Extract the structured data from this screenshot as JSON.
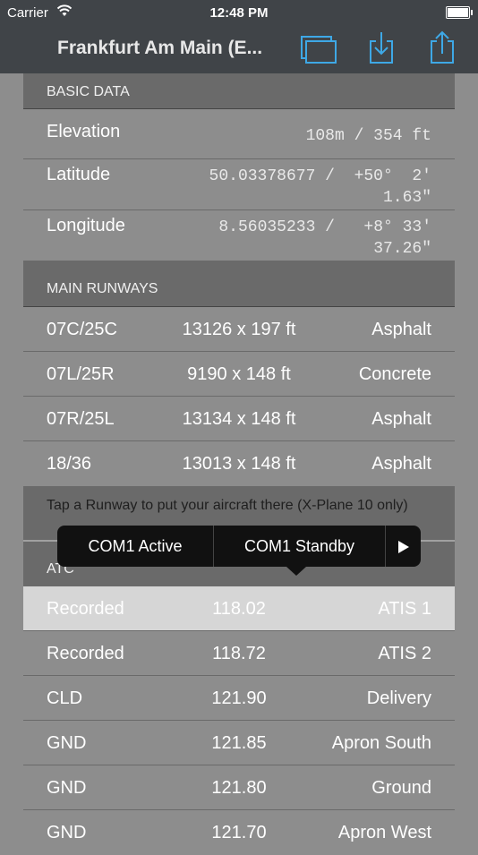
{
  "status_bar": {
    "carrier": "Carrier",
    "time": "12:48 PM"
  },
  "nav": {
    "title": "Frankfurt Am Main (E...",
    "icons": [
      "windows-icon",
      "download-icon",
      "share-icon"
    ]
  },
  "basic": {
    "header": "BASIC DATA",
    "elevation": {
      "label": "Elevation",
      "value": "108m / 354 ft"
    },
    "latitude": {
      "label": "Latitude",
      "value_line1": "50.03378677 /  +50°  2'",
      "value_line2": "1.63\""
    },
    "longitude": {
      "label": "Longitude",
      "value_line1": "8.56035233 /   +8° 33'",
      "value_line2": "37.26\""
    }
  },
  "runways": {
    "header": "MAIN RUNWAYS",
    "rows": [
      {
        "id": "07C/25C",
        "size": "13126 x 197 ft",
        "surface": "Asphalt"
      },
      {
        "id": "07L/25R",
        "size": "9190 x 148 ft",
        "surface": "Concrete"
      },
      {
        "id": "07R/25L",
        "size": "13134 x 148 ft",
        "surface": "Asphalt"
      },
      {
        "id": "18/36",
        "size": "13013 x 148 ft",
        "surface": "Asphalt"
      }
    ],
    "note": "Tap a Runway to put your aircraft there (X-Plane 10 only)"
  },
  "atc": {
    "header": "ATC",
    "rows": [
      {
        "type": "Recorded",
        "freq": "118.02",
        "name": "ATIS 1"
      },
      {
        "type": "Recorded",
        "freq": "118.72",
        "name": "ATIS 2"
      },
      {
        "type": "CLD",
        "freq": "121.90",
        "name": "Delivery"
      },
      {
        "type": "GND",
        "freq": "121.85",
        "name": "Apron South"
      },
      {
        "type": "GND",
        "freq": "121.80",
        "name": "Ground"
      },
      {
        "type": "GND",
        "freq": "121.70",
        "name": "Apron West"
      }
    ]
  },
  "popover": {
    "active": "COM1 Active",
    "standby": "COM1 Standby",
    "more_icon": "play-icon"
  }
}
